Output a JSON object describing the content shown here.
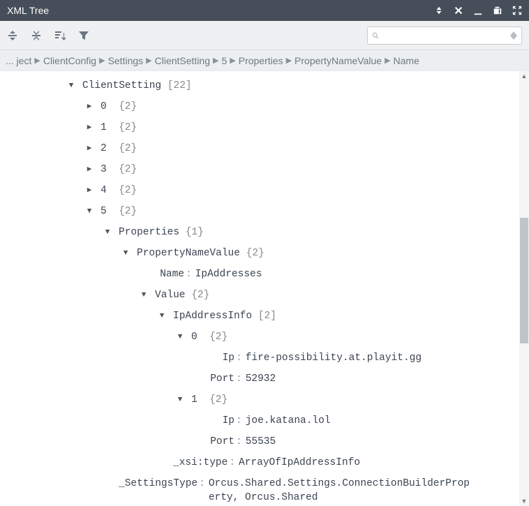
{
  "header": {
    "title": "XML Tree"
  },
  "toolbar": {
    "search_placeholder": ""
  },
  "breadcrumb": [
    "... ject",
    "ClientConfig",
    "Settings",
    "ClientSetting",
    "5",
    "Properties",
    "PropertyNameValue",
    "Name"
  ],
  "tree": {
    "root": {
      "key": "ClientSetting",
      "count": "[22]"
    },
    "collapsed": [
      {
        "idx": "0",
        "count": "{2}"
      },
      {
        "idx": "1",
        "count": "{2}"
      },
      {
        "idx": "2",
        "count": "{2}"
      },
      {
        "idx": "3",
        "count": "{2}"
      },
      {
        "idx": "4",
        "count": "{2}"
      }
    ],
    "expanded": {
      "idx": "5",
      "count": "{2}"
    },
    "properties": {
      "key": "Properties",
      "count": "{1}"
    },
    "pnv": {
      "key": "PropertyNameValue",
      "count": "{2}"
    },
    "name": {
      "key": "Name",
      "value": "IpAddresses"
    },
    "value": {
      "key": "Value",
      "count": "{2}"
    },
    "ipai": {
      "key": "IpAddressInfo",
      "count": "[2]"
    },
    "entry0": {
      "idx": "0",
      "count": "{2}",
      "ip_key": "Ip",
      "ip": "fire-possibility.at.playit.gg",
      "port_key": "Port",
      "port": "52932"
    },
    "entry1": {
      "idx": "1",
      "count": "{2}",
      "ip_key": "Ip",
      "ip": "joe.katana.lol",
      "port_key": "Port",
      "port": "55535"
    },
    "xsi": {
      "key": "_xsi:type",
      "value": "ArrayOfIpAddressInfo"
    },
    "settingsType": {
      "key": "_SettingsType",
      "value": "Orcus.Shared.Settings.ConnectionBuilderProperty, Orcus.Shared"
    }
  }
}
